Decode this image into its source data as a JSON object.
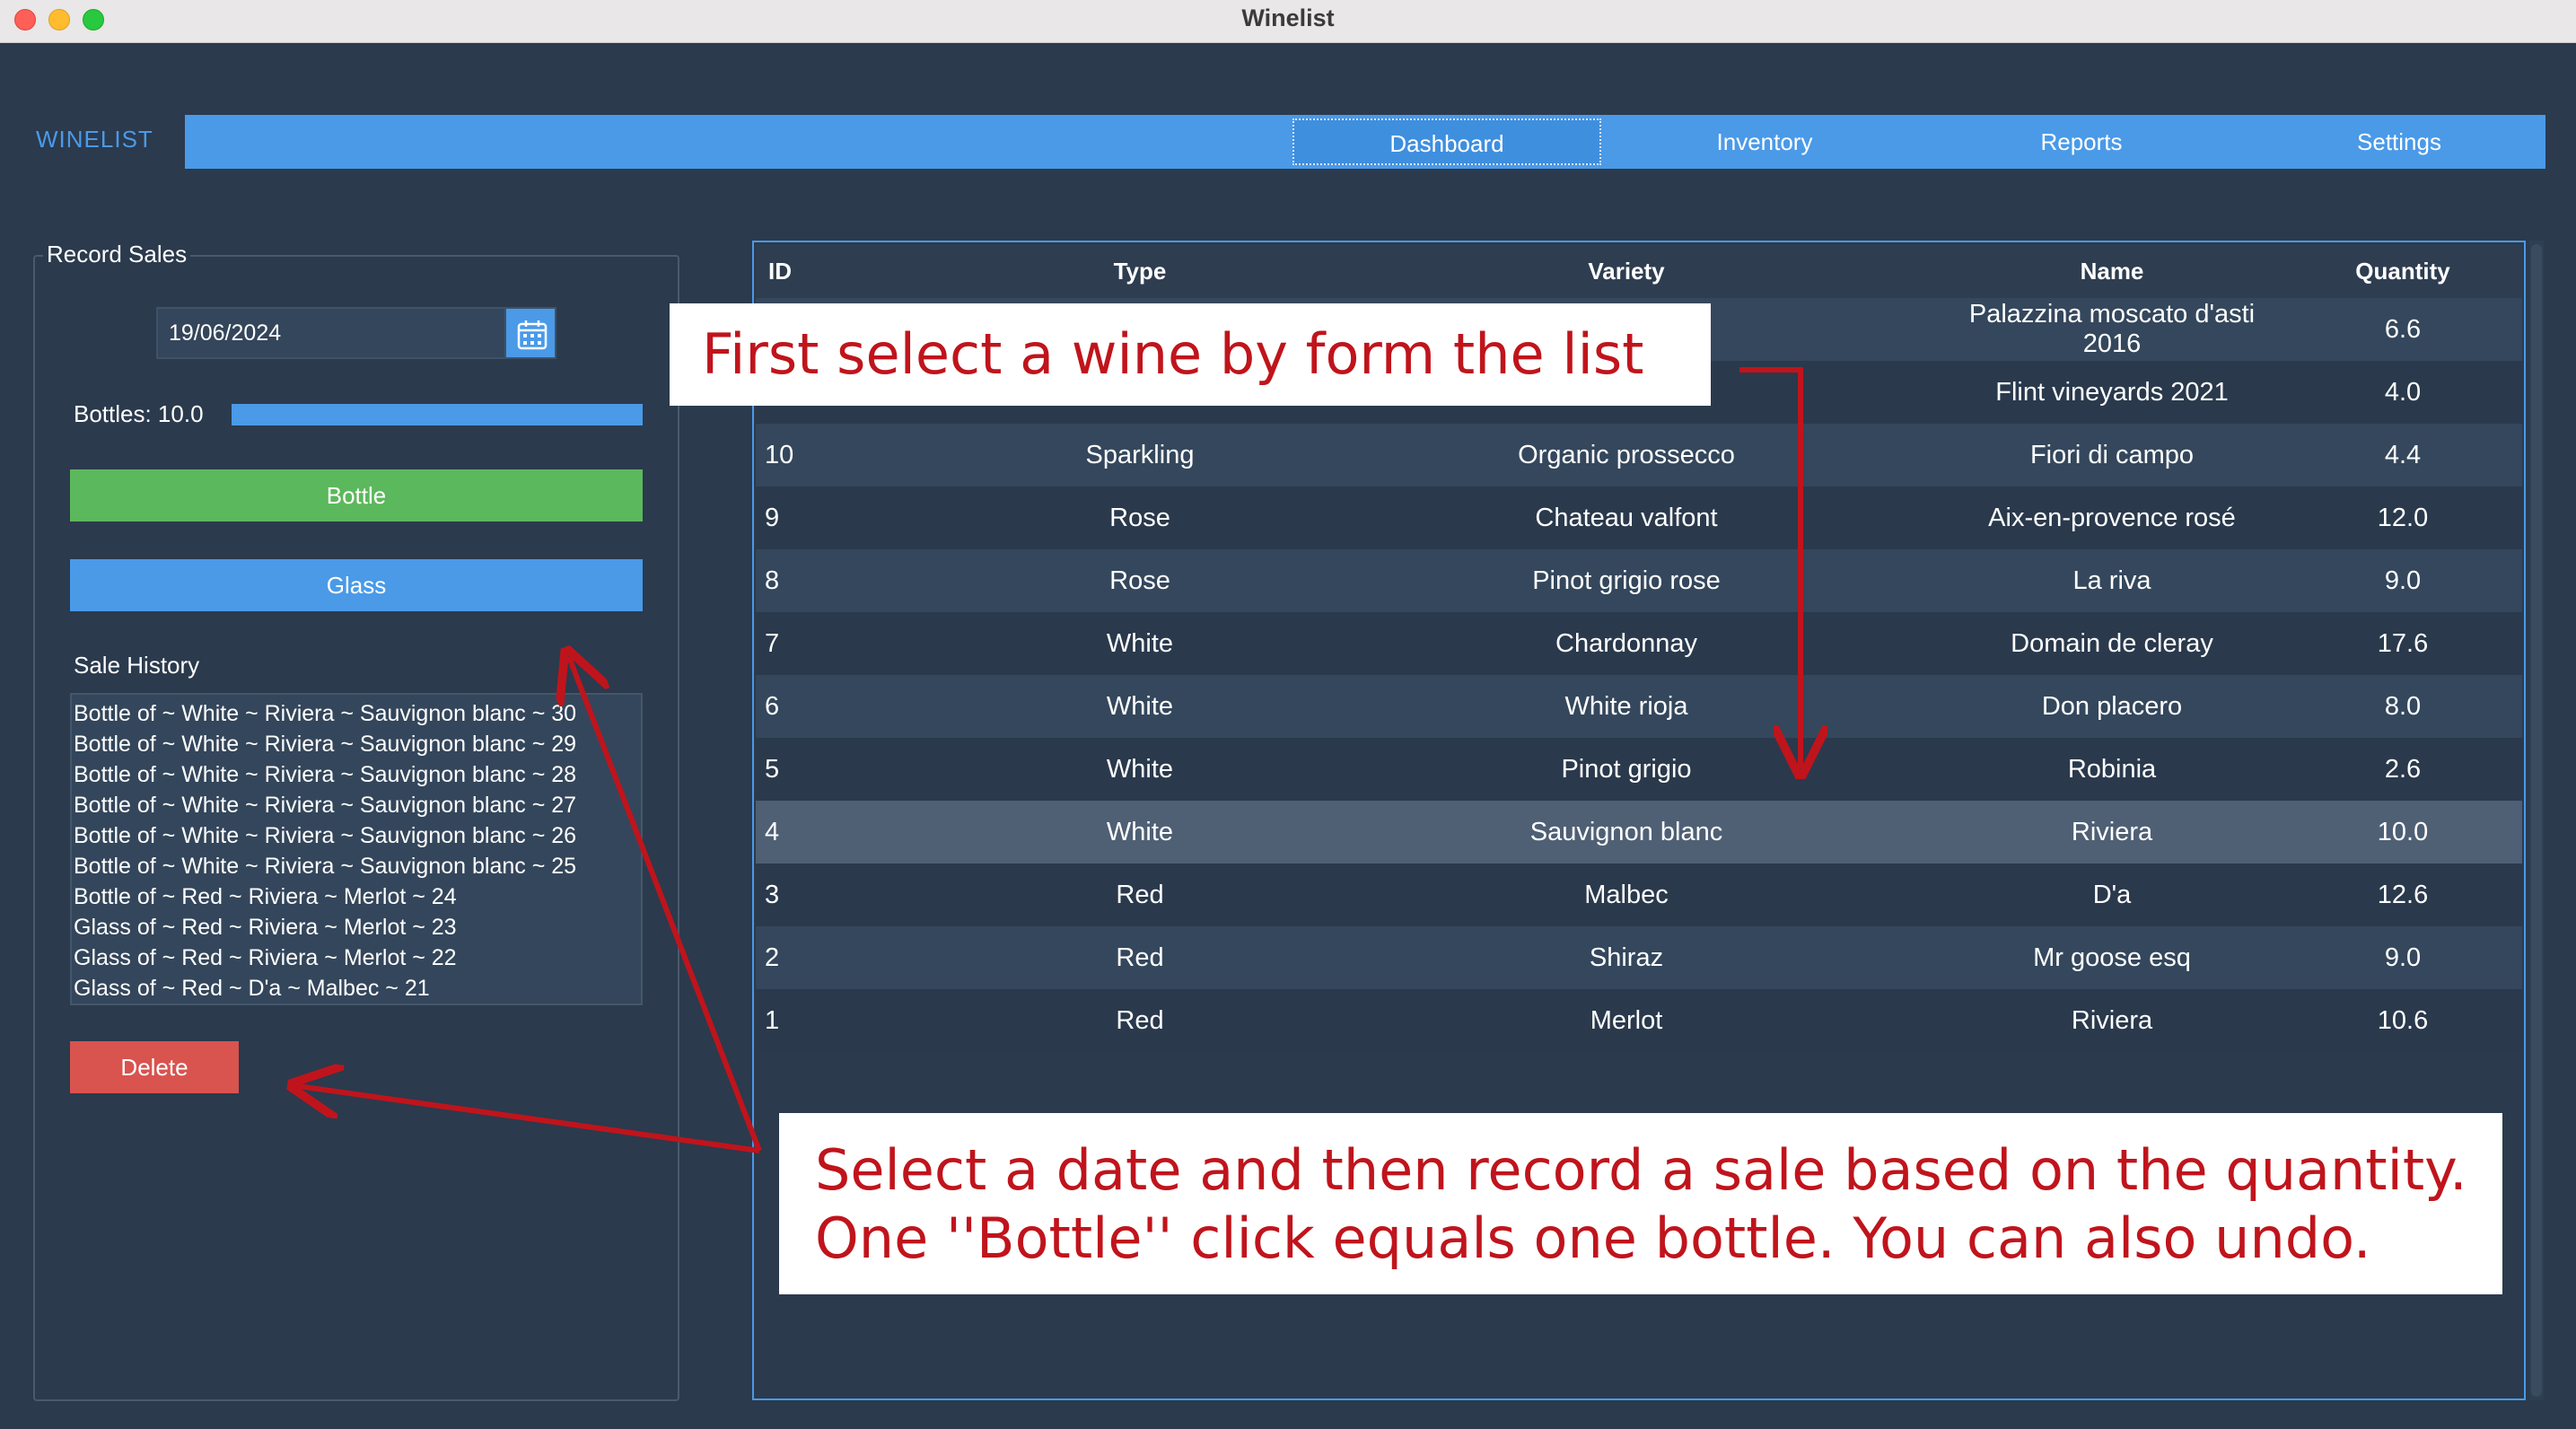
{
  "window": {
    "title": "Winelist"
  },
  "brand": "WINELIST",
  "nav": {
    "tabs": [
      {
        "label": "Dashboard",
        "active": true
      },
      {
        "label": "Inventory",
        "active": false
      },
      {
        "label": "Reports",
        "active": false
      },
      {
        "label": "Settings",
        "active": false
      }
    ]
  },
  "record_sales": {
    "title": "Record Sales",
    "date": "19/06/2024",
    "bottles_label": "Bottles: 10.0",
    "bottles_fill_fraction": 1.0,
    "bottle_button": "Bottle",
    "glass_button": "Glass",
    "sale_history_label": "Sale History",
    "history": [
      "Bottle of  ~ White ~ Riviera ~ Sauvignon blanc ~ 30",
      "Bottle of  ~ White ~ Riviera ~ Sauvignon blanc ~ 29",
      "Bottle of  ~ White ~ Riviera ~ Sauvignon blanc ~ 28",
      "Bottle of  ~ White ~ Riviera ~ Sauvignon blanc ~ 27",
      "Bottle of  ~ White ~ Riviera ~ Sauvignon blanc ~ 26",
      "Bottle of  ~ White ~ Riviera ~ Sauvignon blanc ~ 25",
      "Bottle of  ~ Red ~ Riviera ~ Merlot ~ 24",
      "Glass of  ~ Red ~ Riviera ~ Merlot ~ 23",
      "Glass of  ~ Red ~ Riviera ~ Merlot ~ 22",
      "Glass of  ~ Red ~ D'a ~ Malbec ~ 21"
    ],
    "delete_button": "Delete"
  },
  "table": {
    "headers": [
      "ID",
      "Type",
      "Variety",
      "Name",
      "Quantity"
    ],
    "rows": [
      {
        "id": "",
        "type": "",
        "variety": "",
        "name": "Palazzina moscato d'asti 2016",
        "quantity": "6.6",
        "selected": false
      },
      {
        "id": "",
        "type": "",
        "variety": "",
        "name": "Flint vineyards 2021",
        "quantity": "4.0",
        "selected": false
      },
      {
        "id": "10",
        "type": "Sparkling",
        "variety": "Organic prossecco",
        "name": "Fiori di campo",
        "quantity": "4.4",
        "selected": false
      },
      {
        "id": "9",
        "type": "Rose",
        "variety": "Chateau valfont",
        "name": "Aix-en-provence rosé",
        "quantity": "12.0",
        "selected": false
      },
      {
        "id": "8",
        "type": "Rose",
        "variety": "Pinot grigio rose",
        "name": "La riva",
        "quantity": "9.0",
        "selected": false
      },
      {
        "id": "7",
        "type": "White",
        "variety": "Chardonnay",
        "name": "Domain de cleray",
        "quantity": "17.6",
        "selected": false
      },
      {
        "id": "6",
        "type": "White",
        "variety": "White rioja",
        "name": "Don placero",
        "quantity": "8.0",
        "selected": false
      },
      {
        "id": "5",
        "type": "White",
        "variety": "Pinot grigio",
        "name": "Robinia",
        "quantity": "2.6",
        "selected": false
      },
      {
        "id": "4",
        "type": "White",
        "variety": "Sauvignon blanc",
        "name": "Riviera",
        "quantity": "10.0",
        "selected": true
      },
      {
        "id": "3",
        "type": "Red",
        "variety": "Malbec",
        "name": "D'a",
        "quantity": "12.6",
        "selected": false
      },
      {
        "id": "2",
        "type": "Red",
        "variety": "Shiraz",
        "name": "Mr goose esq",
        "quantity": "9.0",
        "selected": false
      },
      {
        "id": "1",
        "type": "Red",
        "variety": "Merlot",
        "name": "Riviera",
        "quantity": "10.6",
        "selected": false
      }
    ]
  },
  "annotations": {
    "callout_1": "First select a wine by form the list",
    "callout_2_line_1": "Select a date and then record a sale based on the quantity.",
    "callout_2_line_2": "One ''Bottle'' click equals one bottle. You can also undo.",
    "arrow_color": "#c0141c"
  },
  "colors": {
    "background": "#2b3a4d",
    "accent": "#4a9ae8",
    "bottle_button": "#5cb85c",
    "delete_button": "#d9534f"
  },
  "icons": {
    "calendar": "calendar-icon"
  }
}
